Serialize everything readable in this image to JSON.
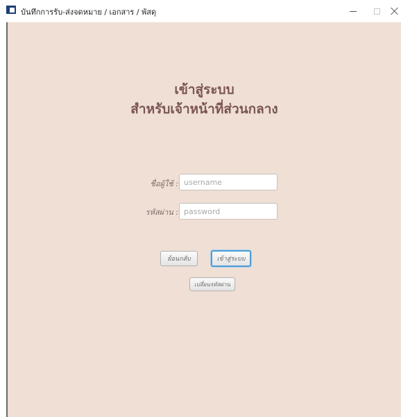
{
  "window": {
    "title": "บันทึกการรับ-ส่งจดหมาย / เอกสาร / พัสดุ",
    "app_icon": "app-window-icon",
    "controls": [
      "minimize-icon",
      "maximize-icon",
      "close-icon"
    ]
  },
  "login": {
    "heading_line1": "เข้าสู่ระบบ",
    "heading_line2": "สำหรับเจ้าหน้าที่ส่วนกลาง",
    "username": {
      "label": "ชื่อผู้ใช้ :",
      "placeholder": "username",
      "value": ""
    },
    "password": {
      "label": "รหัสผ่าน :",
      "placeholder": "password",
      "value": ""
    },
    "back_button": "ย้อนกลับ",
    "login_button": "เข้าสู่ระบบ",
    "change_password_button": "เปลี่ยนรหัสผ่าน"
  },
  "colors": {
    "background": "#efdfd4",
    "heading": "#7a5555",
    "focus_border": "#4f9cd4"
  }
}
